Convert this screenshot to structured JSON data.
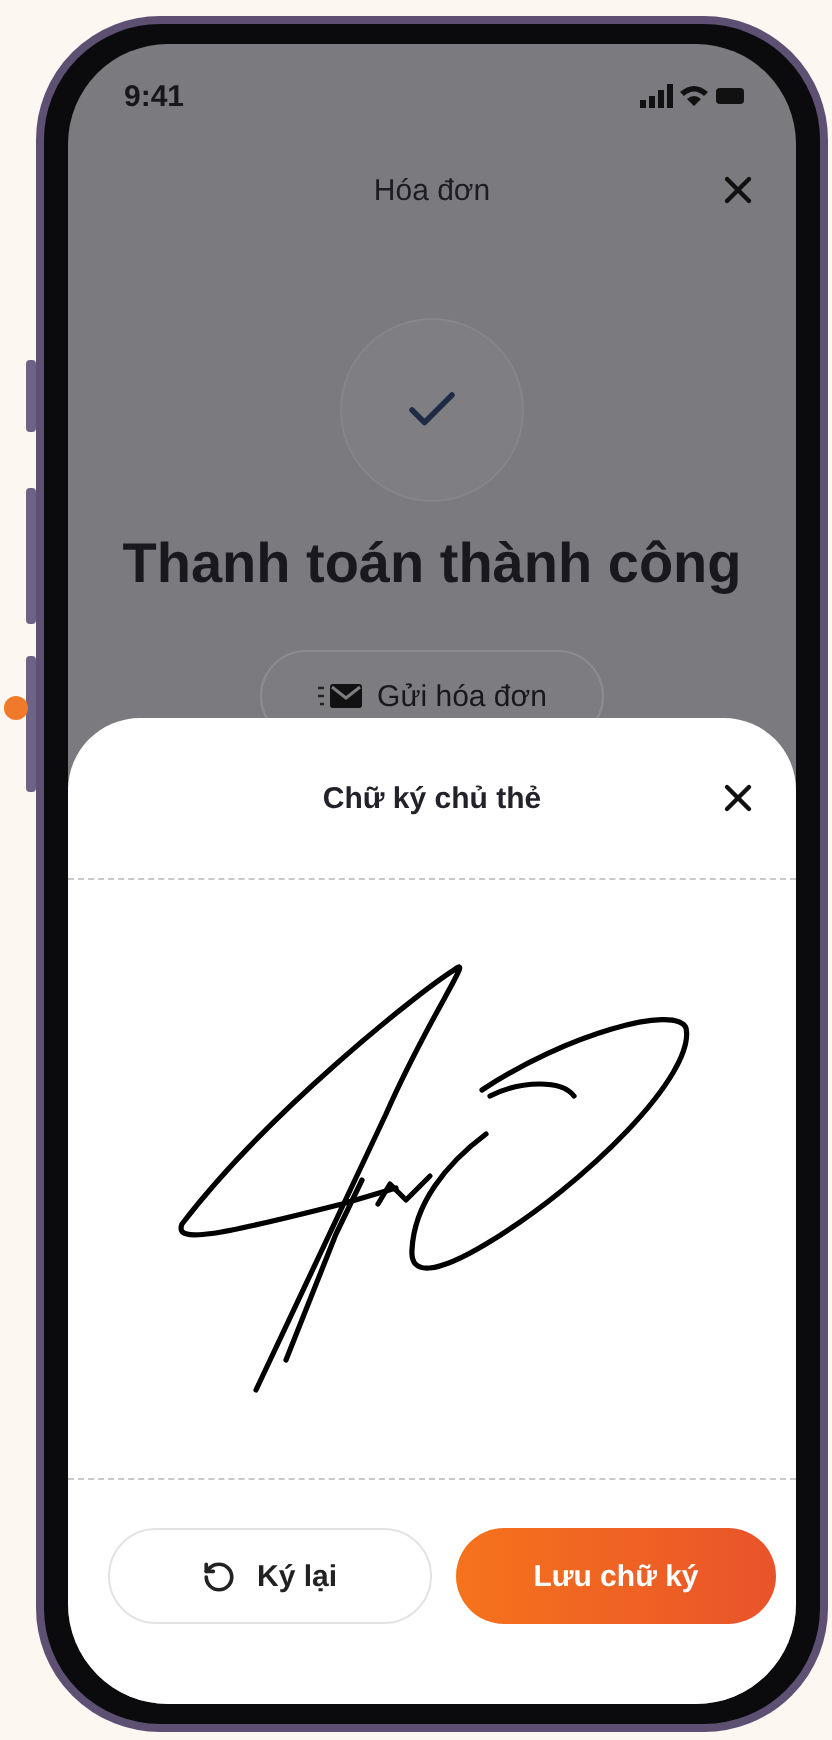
{
  "status_bar": {
    "time": "9:41"
  },
  "header": {
    "title": "Hóa đơn"
  },
  "success": {
    "title": "Thanh toán thành công"
  },
  "send_button": {
    "label": "Gửi hóa đơn"
  },
  "signature_sheet": {
    "title": "Chữ ký chủ thẻ",
    "buttons": [
      {
        "kind": "secondary",
        "label": "Ký lại"
      },
      {
        "kind": "primary",
        "label": "Lưu chữ ký"
      }
    ]
  }
}
